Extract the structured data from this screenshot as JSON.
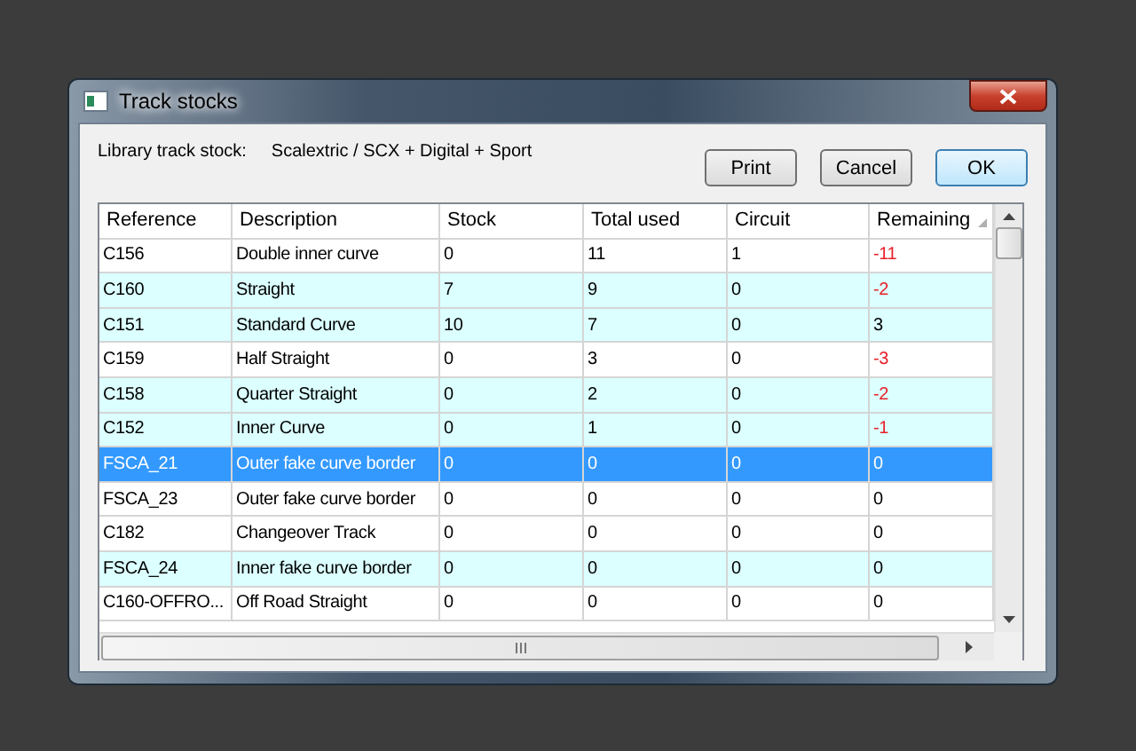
{
  "window": {
    "title": "Track stocks"
  },
  "library": {
    "label": "Library track stock:",
    "value": "Scalextric / SCX + Digital + Sport"
  },
  "buttons": [
    {
      "label": "Print",
      "default": false
    },
    {
      "label": "Cancel",
      "default": false
    },
    {
      "label": "OK",
      "default": true
    }
  ],
  "table": {
    "columns": [
      {
        "label": "Reference",
        "sorted": false
      },
      {
        "label": "Description",
        "sorted": false
      },
      {
        "label": "Stock",
        "sorted": false
      },
      {
        "label": "Total used",
        "sorted": false
      },
      {
        "label": "Circuit",
        "sorted": false
      },
      {
        "label": "Remaining",
        "sorted": true
      }
    ],
    "rows": [
      {
        "cells": [
          "C156",
          "Double inner curve",
          "0",
          "11",
          "1",
          "-11"
        ],
        "tinted": false,
        "negative": true,
        "selected": false
      },
      {
        "cells": [
          "C160",
          "Straight",
          "7",
          "9",
          "0",
          "-2"
        ],
        "tinted": true,
        "negative": true,
        "selected": false
      },
      {
        "cells": [
          "C151",
          "Standard Curve",
          "10",
          "7",
          "0",
          "3"
        ],
        "tinted": true,
        "negative": false,
        "selected": false
      },
      {
        "cells": [
          "C159",
          "Half Straight",
          "0",
          "3",
          "0",
          "-3"
        ],
        "tinted": false,
        "negative": true,
        "selected": false
      },
      {
        "cells": [
          "C158",
          "Quarter Straight",
          "0",
          "2",
          "0",
          "-2"
        ],
        "tinted": true,
        "negative": true,
        "selected": false
      },
      {
        "cells": [
          "C152",
          "Inner Curve",
          "0",
          "1",
          "0",
          "-1"
        ],
        "tinted": true,
        "negative": true,
        "selected": false
      },
      {
        "cells": [
          "FSCA_21",
          "Outer fake curve border",
          "0",
          "0",
          "0",
          "0"
        ],
        "tinted": false,
        "negative": false,
        "selected": true
      },
      {
        "cells": [
          "FSCA_23",
          "Outer fake curve border",
          "0",
          "0",
          "0",
          "0"
        ],
        "tinted": false,
        "negative": false,
        "selected": false
      },
      {
        "cells": [
          "C182",
          "Changeover Track",
          "0",
          "0",
          "0",
          "0"
        ],
        "tinted": false,
        "negative": false,
        "selected": false
      },
      {
        "cells": [
          "FSCA_24",
          "Inner fake curve border",
          "0",
          "0",
          "0",
          "0"
        ],
        "tinted": true,
        "negative": false,
        "selected": false
      },
      {
        "cells": [
          "C160-OFFRO...",
          "Off Road Straight",
          "0",
          "0",
          "0",
          "0"
        ],
        "tinted": false,
        "negative": false,
        "selected": false
      }
    ]
  }
}
